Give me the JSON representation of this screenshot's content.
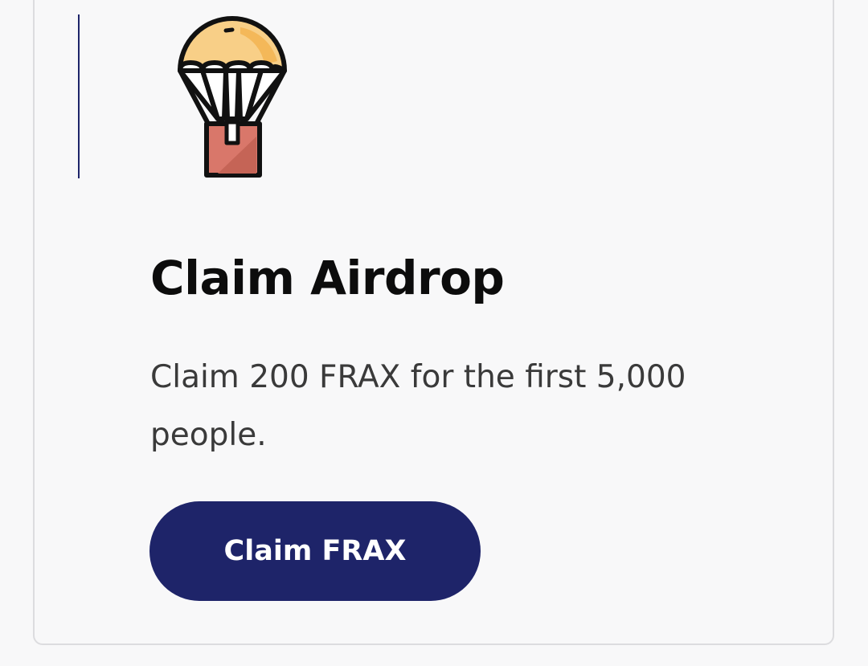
{
  "card": {
    "icon": "parachute-airdrop-icon",
    "title": "Claim Airdrop",
    "description": "Claim 200 FRAX for the first 5,000 people.",
    "button_label": "Claim FRAX"
  },
  "colors": {
    "accent": "#1e2469",
    "canopy": "#f7c36b",
    "box": "#d9776a"
  }
}
